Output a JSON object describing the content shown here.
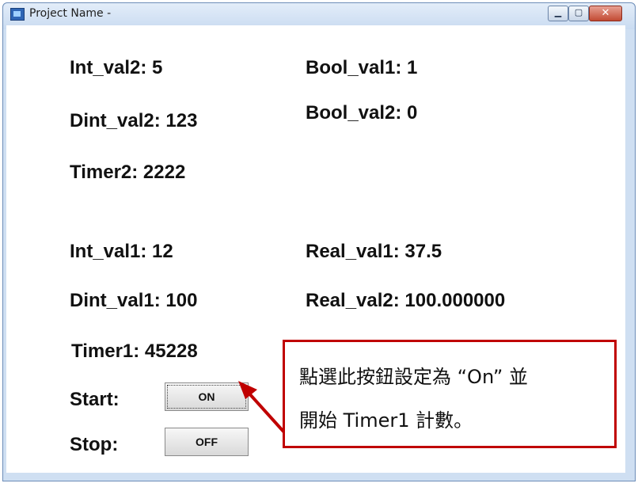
{
  "window": {
    "title": "Project Name -",
    "controls": {
      "minimize": "▁",
      "maximize": "▢",
      "close": "✕"
    }
  },
  "values": {
    "int_val2": "Int_val2: 5",
    "bool_val1": "Bool_val1: 1",
    "dint_val2": "Dint_val2: 123",
    "bool_val2": "Bool_val2: 0",
    "timer2": "Timer2: 2222",
    "int_val1": "Int_val1: 12",
    "real_val1": "Real_val1: 37.5",
    "dint_val1": "Dint_val1: 100",
    "real_val2": "Real_val2: 100.000000",
    "timer1": "Timer1: 45228"
  },
  "controls": {
    "start_label": "Start:",
    "on_button": "ON",
    "stop_label": "Stop:",
    "off_button": "OFF"
  },
  "callout": {
    "line1": "點選此按鈕設定為 “On” 並",
    "line2": "開始  Timer1  計數。",
    "color": "#c00000"
  }
}
